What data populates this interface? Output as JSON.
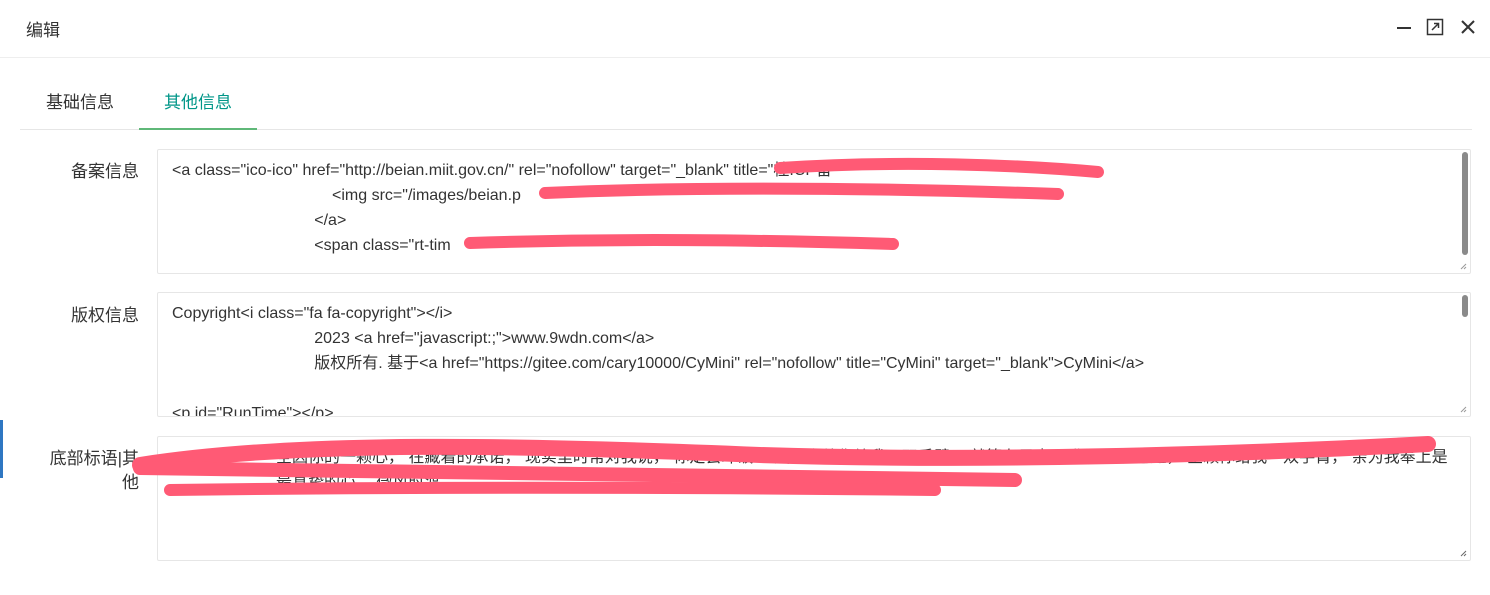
{
  "dialog": {
    "title": "编辑"
  },
  "tabs": [
    {
      "label": "基础信息",
      "active": false
    },
    {
      "label": "其他信息",
      "active": true
    }
  ],
  "fields": {
    "beian": {
      "label": "备案信息",
      "value": "<a class=\"ico-ico\" href=\"http://beian.miit.gov.cn/\" rel=\"nofollow\" target=\"_blank\" title=\"桂ICP备\n                                    <img src=\"/images/beian.p\n                                </a>\n                                <span class=\"rt-tim"
    },
    "copyright": {
      "label": "版权信息",
      "value": "Copyright<i class=\"fa fa-copyright\"></i>\n                                2023 <a href=\"javascript:;\">www.9wdn.com</a>\n                                版权所有. 基于<a href=\"https://gitee.com/cary10000/CyMini\" rel=\"nofollow\" title=\"CyMini\" target=\"_blank\">CyMini</a>\n\n<p id=\"RunTime\"></p>"
    },
    "footer": {
      "label": "底部标语|其他",
      "value": "全因你的一颗心， 在藏着的承诺， 现实里时常对我说， 你定会冲破一切， 全赖你给我一双手臂， 就算在风中， 你也总及这避， 全赖你给我一双手臂， 亲为我奉上是最真挚的心， 微风时渡"
    }
  },
  "colors": {
    "accent": "#009688",
    "tab_underline": "#5fb878",
    "redaction": "#ff5a75"
  }
}
